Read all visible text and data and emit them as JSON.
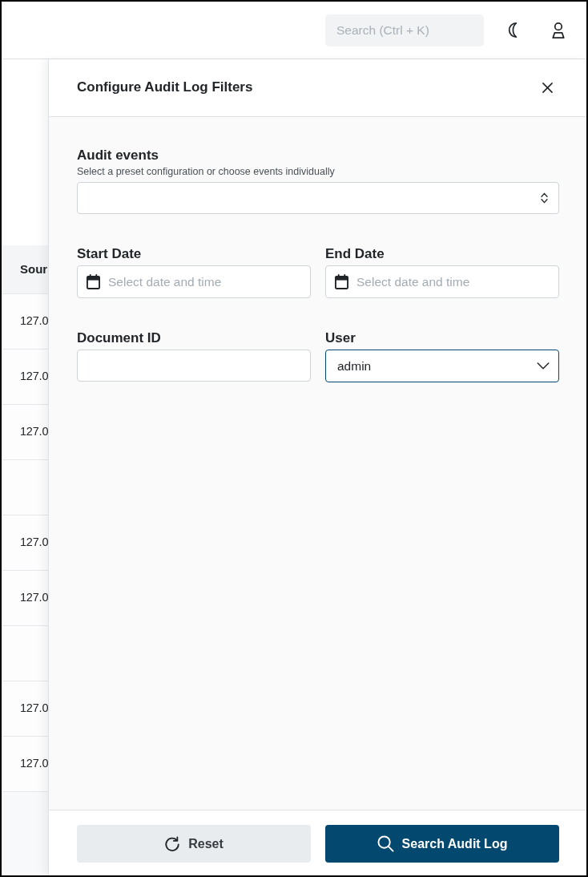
{
  "header": {
    "search": {
      "placeholder": "Search (Ctrl + K)"
    }
  },
  "page_table": {
    "columns": [
      "Sour"
    ],
    "rows": [
      {
        "column_1": "127.0"
      },
      {
        "column_1": "127.0"
      },
      {
        "column_1": "127.0"
      },
      {},
      {
        "column_1": "127.0"
      },
      {
        "column_1": "127.0"
      },
      {},
      {
        "column_1": "127.0"
      },
      {
        "column_1": "127.0"
      }
    ]
  },
  "panel": {
    "title": "Configure Audit Log Filters",
    "field_rows": [
      {
        "fields": [
          {
            "kind": "multiselect",
            "label": "Audit events",
            "hint": "Select a preset configuration or choose events individually",
            "focused": false
          }
        ]
      },
      {
        "fields": [
          {
            "kind": "date",
            "label": "Start Date",
            "placeholder": "Select date and time",
            "focused": false
          },
          {
            "kind": "date",
            "label": "End Date",
            "placeholder": "Select date and time",
            "focused": false
          }
        ]
      },
      {
        "fields": [
          {
            "kind": "text",
            "label": "Document ID",
            "focused": false
          },
          {
            "kind": "select",
            "label": "User",
            "value": "admin",
            "focused": true
          }
        ]
      }
    ],
    "buttons": [
      {
        "kind": "secondary",
        "label": "Reset"
      },
      {
        "kind": "primary",
        "label": "Search Audit Log"
      }
    ]
  }
}
